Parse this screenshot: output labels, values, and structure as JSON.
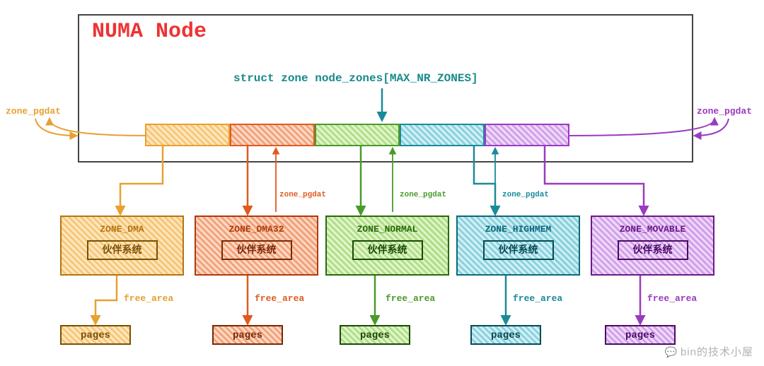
{
  "numa_title": "NUMA Node",
  "struct_label": "struct zone node_zones[MAX_NR_ZONES]",
  "pgdat_left": "zone_pgdat",
  "pgdat_right": "zone_pgdat",
  "pgdat_mid1": "zone_pgdat",
  "pgdat_mid2": "zone_pgdat",
  "pgdat_mid3": "zone_pgdat",
  "zones": [
    {
      "name": "ZONE_DMA",
      "buddy": "伙伴系统",
      "free": "free_area",
      "pages": "pages",
      "color": "orange"
    },
    {
      "name": "ZONE_DMA32",
      "buddy": "伙伴系统",
      "free": "free_area",
      "pages": "pages",
      "color": "dorange"
    },
    {
      "name": "ZONE_NORMAL",
      "buddy": "伙伴系统",
      "free": "free_area",
      "pages": "pages",
      "color": "green"
    },
    {
      "name": "ZONE_HIGHMEM",
      "buddy": "伙伴系统",
      "free": "free_area",
      "pages": "pages",
      "color": "teal"
    },
    {
      "name": "ZONE_MOVABLE",
      "buddy": "伙伴系统",
      "free": "free_area",
      "pages": "pages",
      "color": "purple"
    }
  ],
  "colors": {
    "orange": "#e8a030",
    "dorange": "#e05a1f",
    "green": "#4a9a2a",
    "teal": "#1a8a9a",
    "purple": "#9a3ac0"
  },
  "watermark": "bin的技术小屋"
}
